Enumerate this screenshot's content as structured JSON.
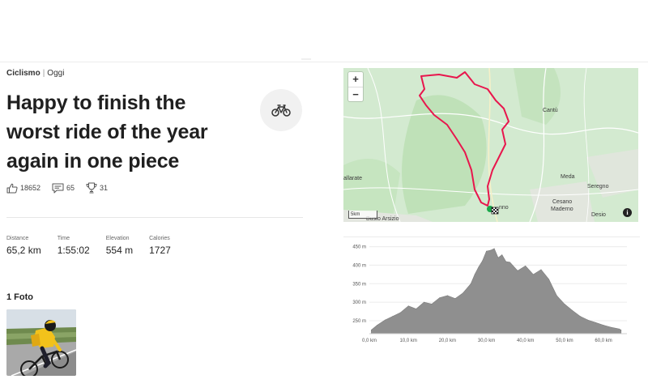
{
  "activity": {
    "sport": "Ciclismo",
    "date": "Oggi",
    "title_lines": [
      "Happy to finish the",
      "worst ride of the year",
      "again in one piece"
    ],
    "sport_icon": "bicycle-icon"
  },
  "social": {
    "kudos": "18652",
    "comments": "65",
    "achievements": "31"
  },
  "stats": [
    {
      "label": "Distance",
      "value": "65,2 km"
    },
    {
      "label": "Time",
      "value": "1:55:02"
    },
    {
      "label": "Elevation",
      "value": "554 m"
    },
    {
      "label": "Calories",
      "value": "1727"
    }
  ],
  "photos": {
    "heading": "1 Foto"
  },
  "map": {
    "zoom_in": "+",
    "zoom_out": "−",
    "scale": "5km",
    "info": "i",
    "places": [
      "Cantù",
      "Meda",
      "Seregno",
      "Cesano",
      "Maderno",
      "Desio",
      "allarate",
      "Busto Arsizio",
      "nno"
    ],
    "route_color": "#e8164d"
  },
  "chart_data": {
    "type": "area",
    "x": [
      0.5,
      2,
      4,
      6,
      8,
      10,
      12,
      14,
      16,
      18,
      20,
      22,
      24,
      26,
      27,
      28,
      29,
      30,
      31,
      32,
      33,
      34,
      35,
      36,
      38,
      40,
      42,
      44,
      46,
      48,
      50,
      52,
      54,
      56,
      58,
      60,
      62,
      64,
      64.5
    ],
    "values": [
      225,
      238,
      252,
      262,
      272,
      290,
      282,
      300,
      295,
      312,
      318,
      310,
      325,
      350,
      375,
      395,
      412,
      438,
      440,
      445,
      420,
      428,
      410,
      408,
      385,
      398,
      375,
      388,
      362,
      318,
      295,
      278,
      262,
      252,
      245,
      238,
      232,
      228,
      225
    ],
    "x_ticks": [
      "0,0 km",
      "10,0 km",
      "20,0 km",
      "30,0 km",
      "40,0 km",
      "50,0 km",
      "60,0 km"
    ],
    "x_tick_values": [
      0,
      10,
      20,
      30,
      40,
      50,
      60
    ],
    "y_ticks": [
      "250 m",
      "300 m",
      "350 m",
      "400 m",
      "450 m"
    ],
    "y_tick_values": [
      250,
      300,
      350,
      400,
      450
    ],
    "xlim": [
      0,
      66
    ],
    "ylim": [
      215,
      460
    ],
    "fill_color": "#8f8f8f",
    "grid": true
  }
}
